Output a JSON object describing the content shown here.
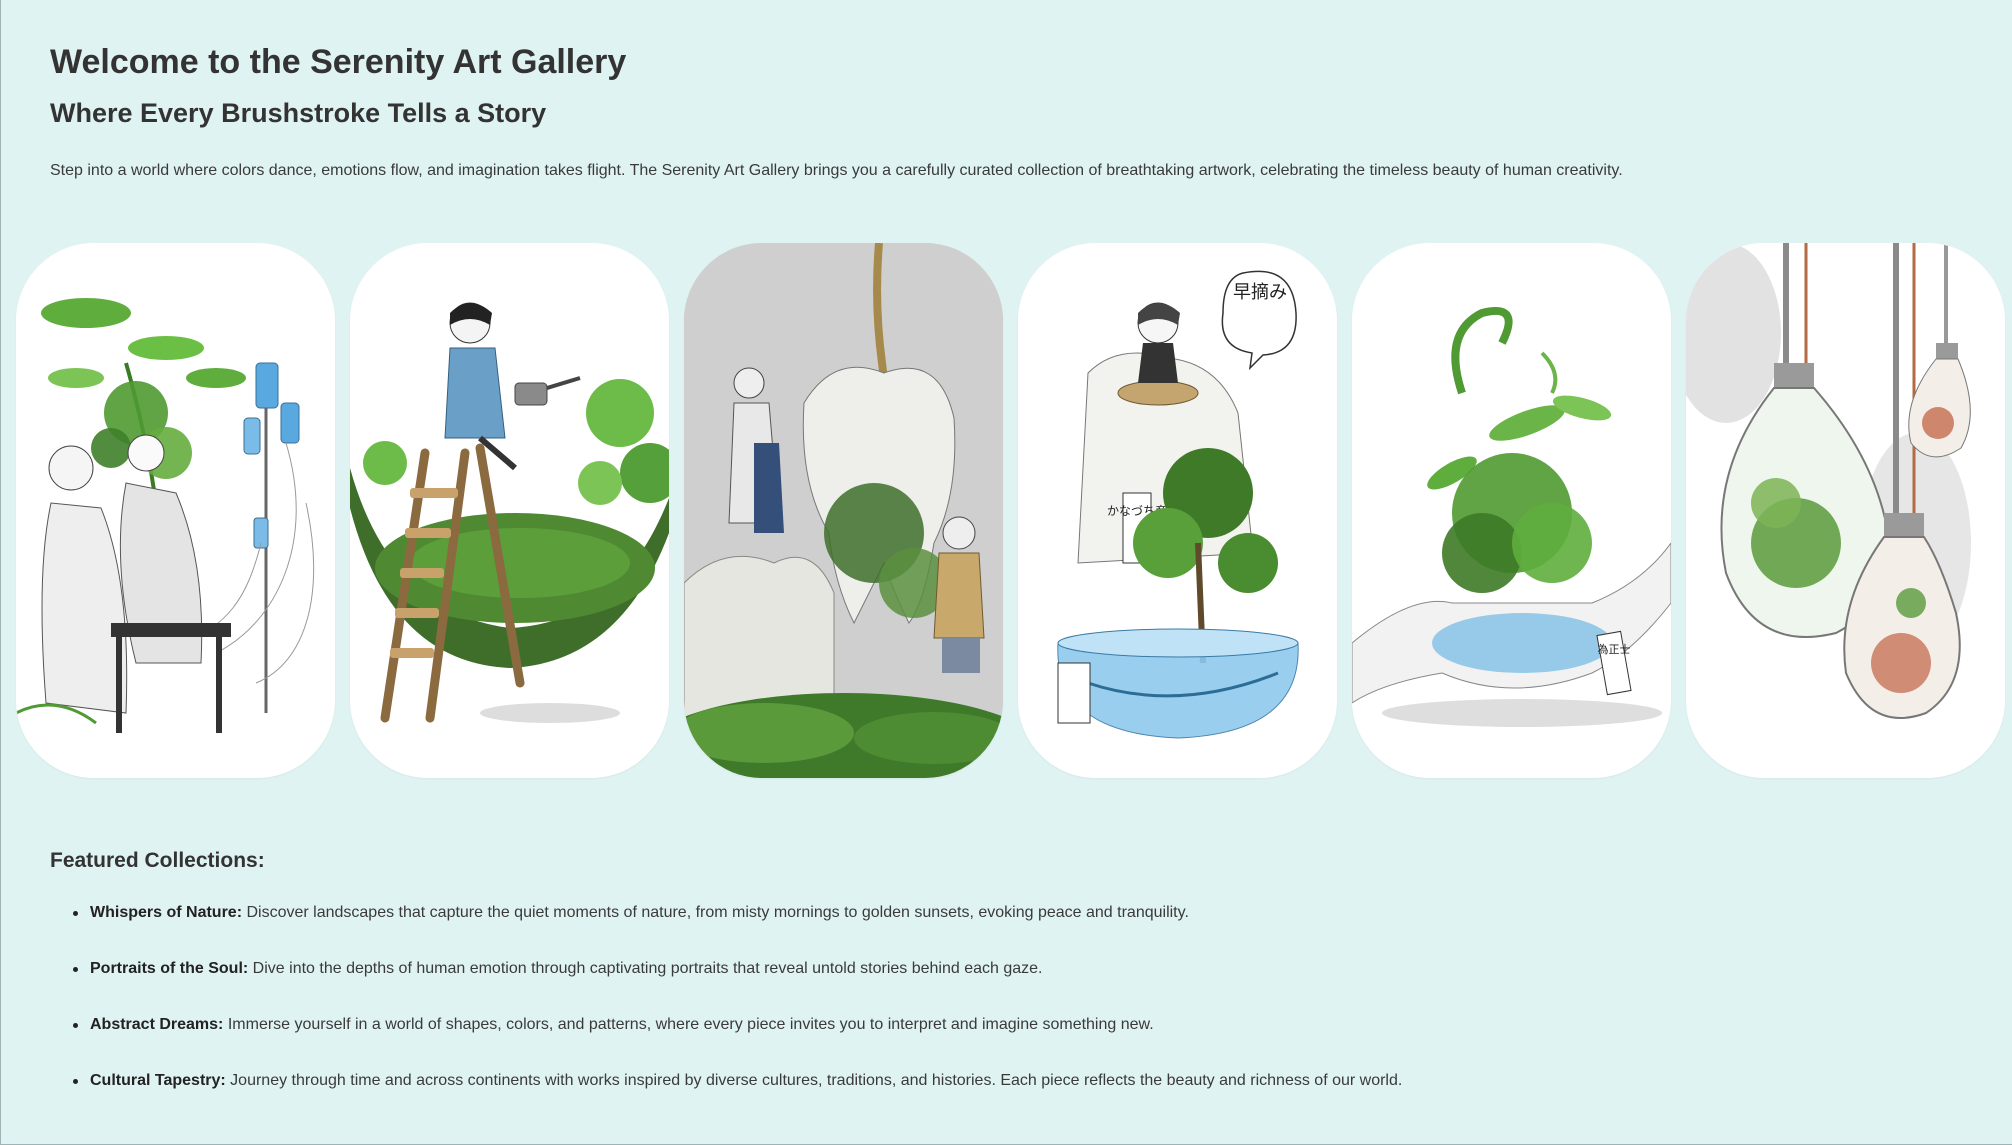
{
  "page": {
    "title": "Welcome to the Serenity Art Gallery",
    "subtitle": "Where Every Brushstroke Tells a Story",
    "intro": "Step into a world where colors dance, emotions flow, and imagination takes flight. The Serenity Art Gallery brings you a carefully curated collection of breathtaking artwork, celebrating the timeless beauty of human creativity."
  },
  "gallery": {
    "artworks": [
      {
        "icon": "hospital-garden-artwork"
      },
      {
        "icon": "watering-ladder-artwork"
      },
      {
        "icon": "tooth-garden-artwork"
      },
      {
        "icon": "tooth-jar-artwork"
      },
      {
        "icon": "plant-bag-artwork"
      },
      {
        "icon": "lightbulb-terrarium-artwork"
      }
    ],
    "speech_bubble": "早摘み",
    "jar_label": "かなづち産",
    "bag_tag": "為正士"
  },
  "featured": {
    "heading": "Featured Collections:",
    "items": [
      {
        "name": "Whispers of Nature:",
        "text": " Discover landscapes that capture the quiet moments of nature, from misty mornings to golden sunsets, evoking peace and tranquility."
      },
      {
        "name": "Portraits of the Soul:",
        "text": " Dive into the depths of human emotion through captivating portraits that reveal untold stories behind each gaze."
      },
      {
        "name": "Abstract Dreams:",
        "text": " Immerse yourself in a world of shapes, colors, and patterns, where every piece invites you to interpret and imagine something new."
      },
      {
        "name": "Cultural Tapestry:",
        "text": " Journey through time and across continents with works inspired by diverse cultures, traditions, and histories. Each piece reflects the beauty and richness of our world."
      }
    ]
  },
  "colors": {
    "background": "#e0f3f3",
    "card": "#ffffff",
    "leaf_green": "#4f9a32",
    "dark_green": "#2f5e22",
    "water_blue": "#3f9ad6"
  }
}
